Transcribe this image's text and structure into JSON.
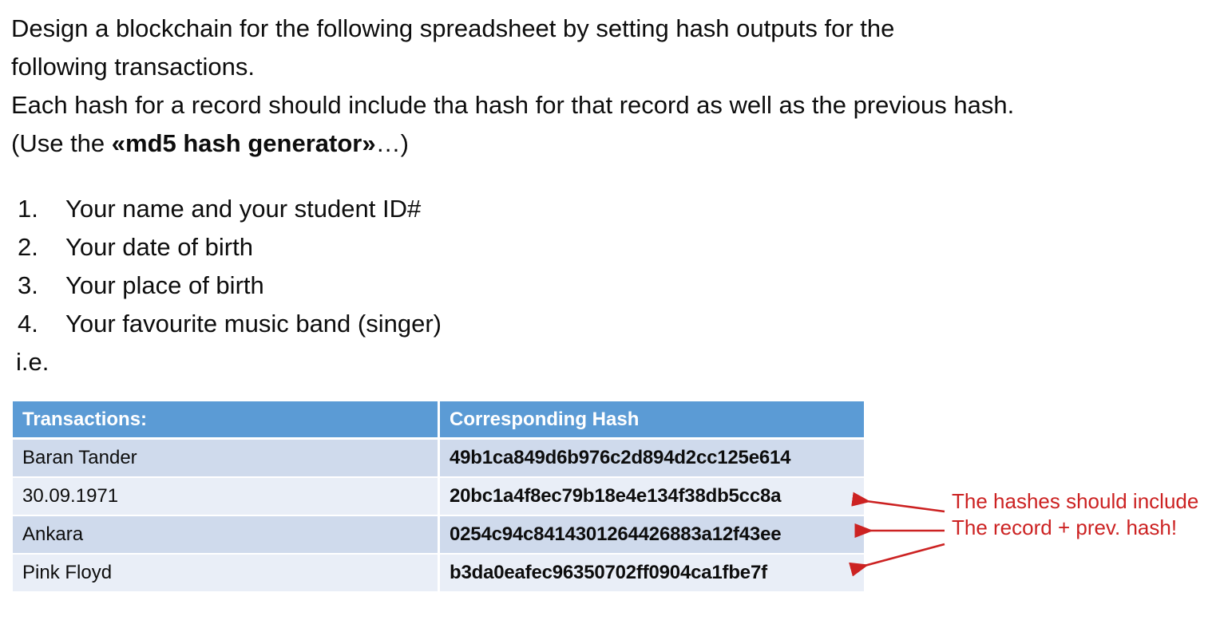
{
  "intro": {
    "line1": "Design a blockchain for the following spreadsheet by setting hash outputs for the",
    "line2": "following transactions.",
    "line3": "Each hash for a record should include tha hash for that record as well as the previous hash.",
    "line4_prefix": "(Use the ",
    "line4_bold": "«md5 hash generator»",
    "line4_suffix": "…)"
  },
  "task_list": [
    {
      "num": "1.",
      "text": "Your name and your student ID#"
    },
    {
      "num": "2.",
      "text": "Your date of birth"
    },
    {
      "num": "3.",
      "text": "Your place of birth"
    },
    {
      "num": "4.",
      "text": "Your favourite music band (singer)"
    }
  ],
  "ie_label": "i.e.",
  "table": {
    "headers": {
      "transactions": "Transactions:",
      "hash": "Corresponding Hash"
    },
    "rows": [
      {
        "transaction": "Baran Tander",
        "hash": "49b1ca849d6b976c2d894d2cc125e614"
      },
      {
        "transaction": "30.09.1971",
        "hash": "20bc1a4f8ec79b18e4e134f38db5cc8a"
      },
      {
        "transaction": "Ankara",
        "hash": "0254c94c8414301264426883a12f43ee"
      },
      {
        "transaction": "Pink Floyd",
        "hash": "b3da0eafec96350702ff0904ca1fbe7f"
      }
    ]
  },
  "annotation": {
    "line1": "The hashes should include",
    "line2": "The record + prev. hash!",
    "color": "#CC2222"
  },
  "colors": {
    "header_blue": "#5B9BD5",
    "row_dark": "#CFDAEC",
    "row_light": "#E9EEF7",
    "text": "#0D0D0D",
    "annotation_red": "#CC2222"
  }
}
